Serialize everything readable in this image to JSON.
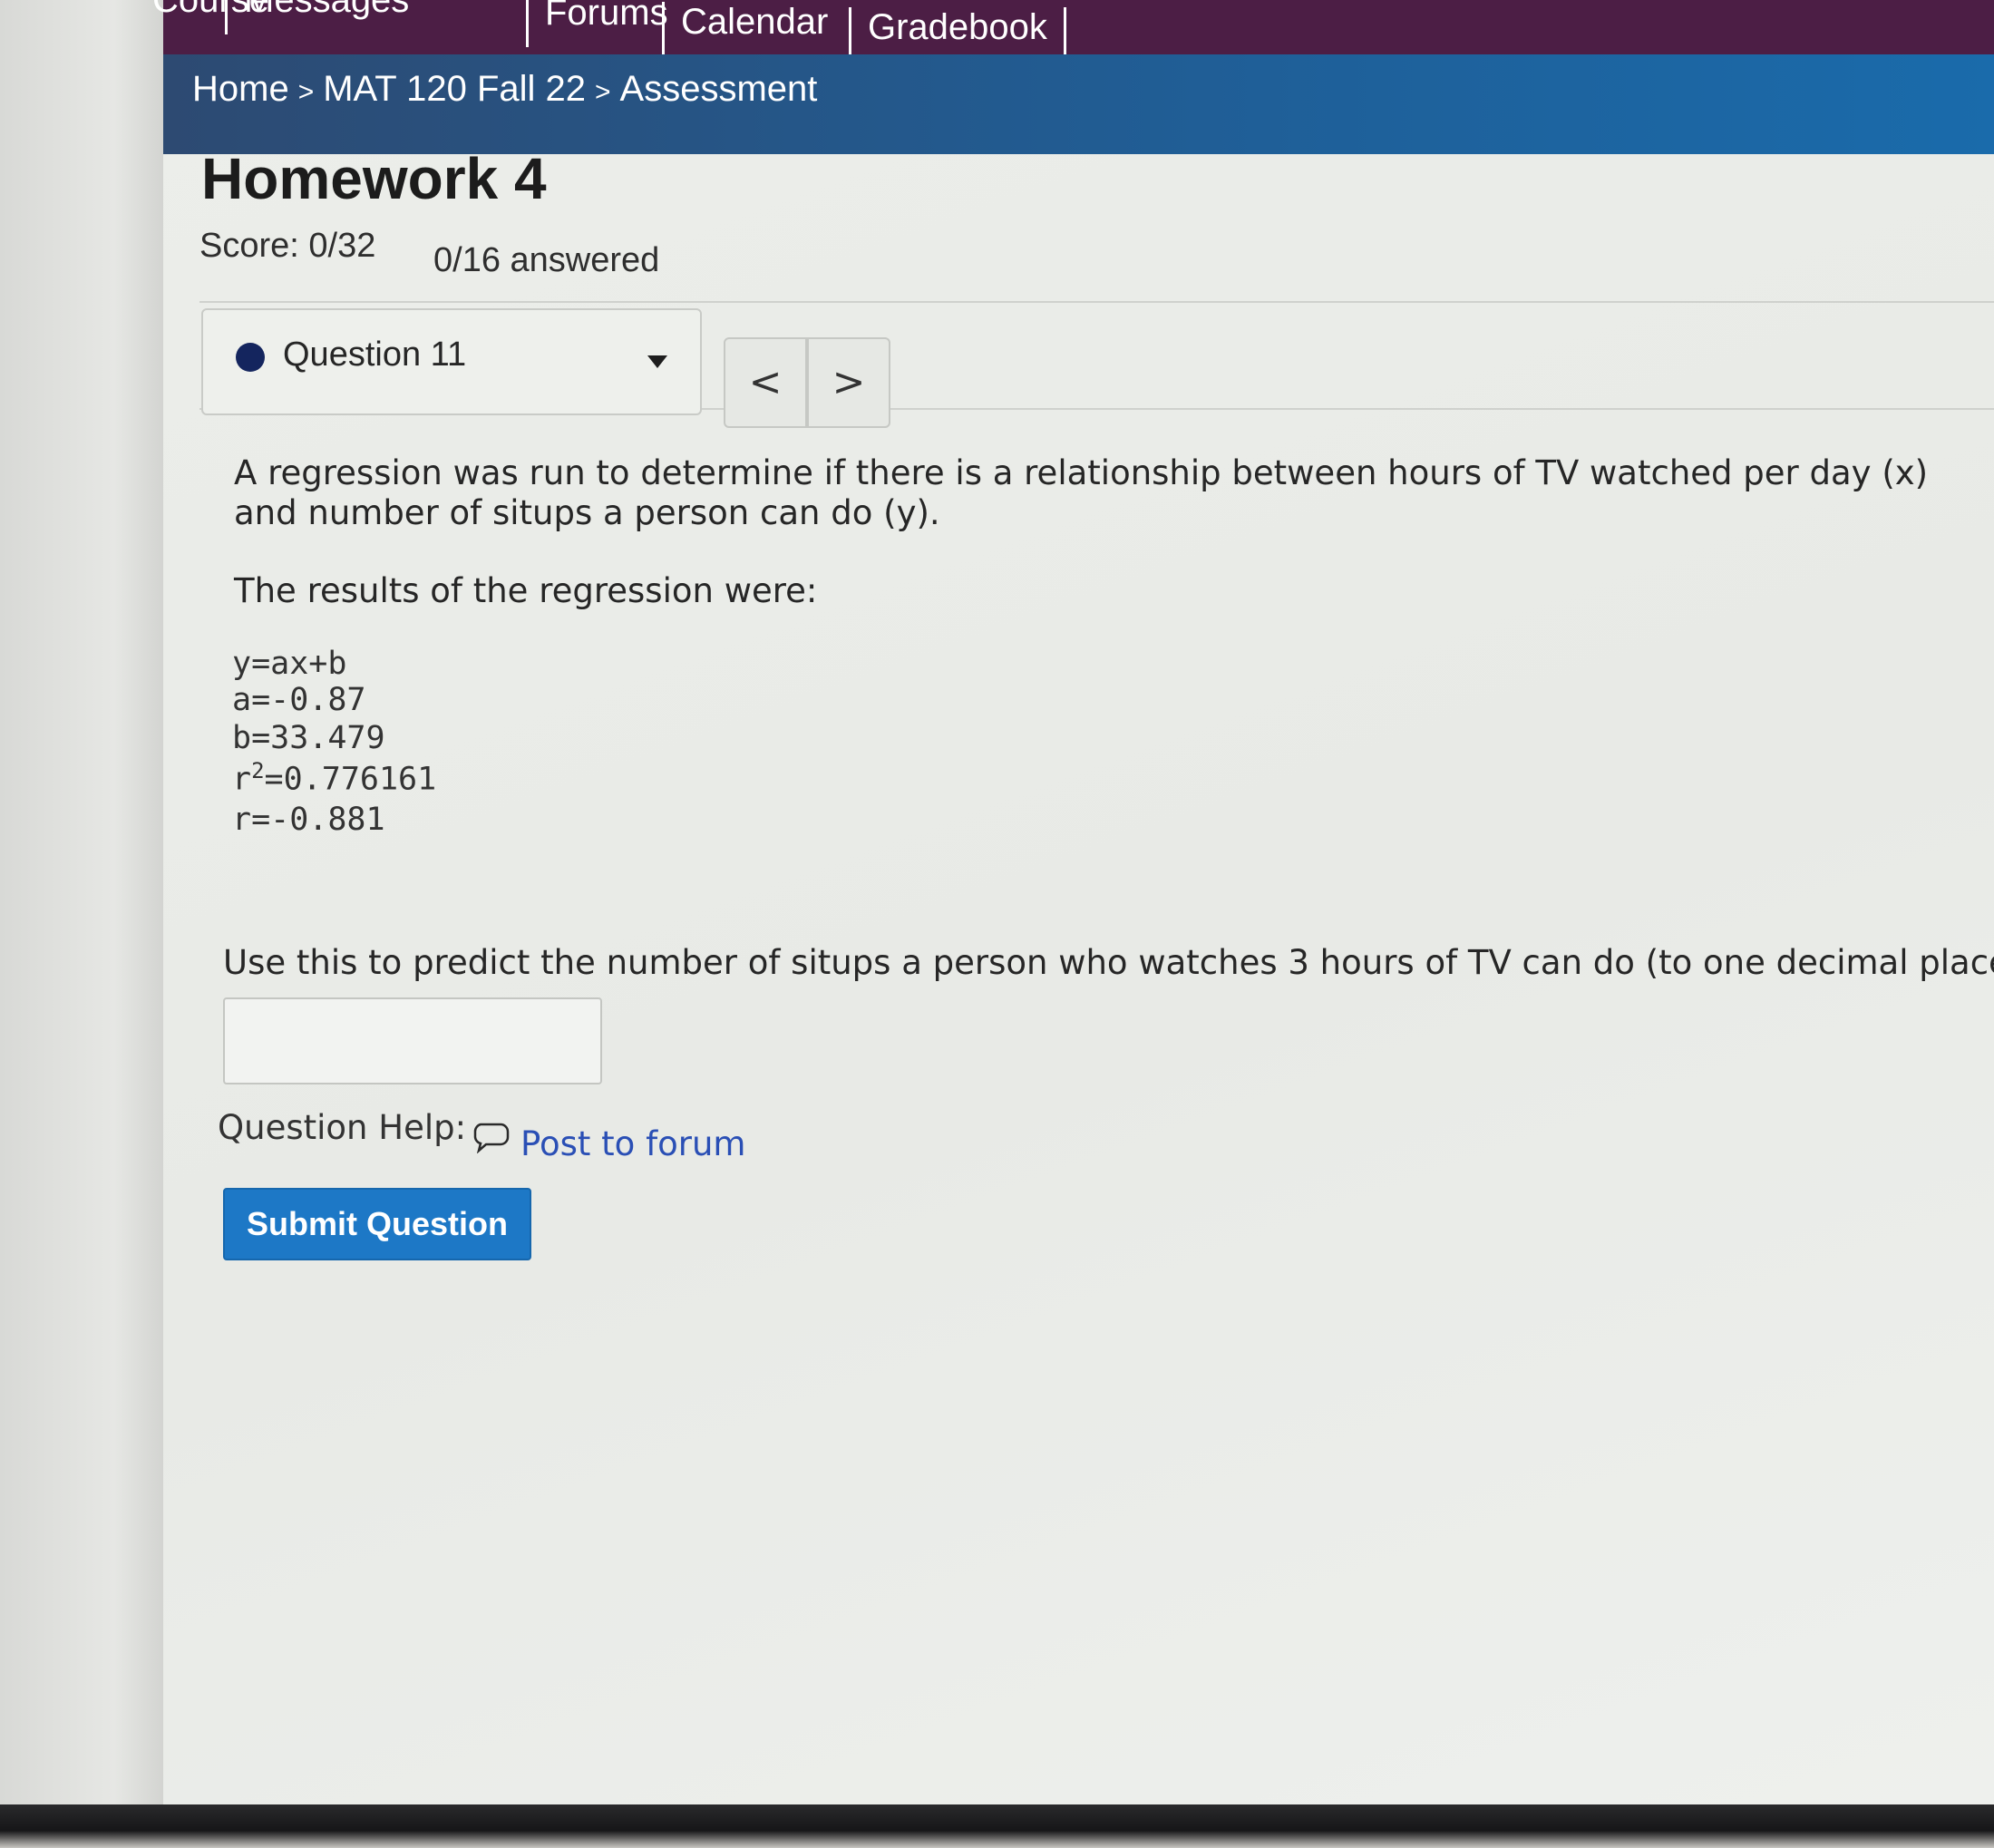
{
  "nav": {
    "tabs": [
      "Course",
      "Messages",
      "Forums",
      "Calendar",
      "Gradebook"
    ]
  },
  "breadcrumb": {
    "items": [
      "Home",
      "MAT 120 Fall 22",
      "Assessment"
    ],
    "separator": ">"
  },
  "assessment": {
    "title": "Homework 4",
    "score": "Score: 0/32",
    "answered": "0/16 answered"
  },
  "question_nav": {
    "selected": "Question 11",
    "prev_symbol": "<",
    "next_symbol": ">"
  },
  "question": {
    "text": "A regression was run to determine if there is a relationship between hours of TV watched per day (x) and number of situps a person can do (y).",
    "results_intro": "The results of the regression were:",
    "equation": "y=ax+b",
    "a": "a=-0.87",
    "b": "b=33.479",
    "r2_prefix": "r",
    "r2_exp": "2",
    "r2_value": "=0.776161",
    "r": "r=-0.881",
    "prompt": "Use this to predict the number of situps a person who watches 3 hours of TV can do (to one decimal place)",
    "answer_value": ""
  },
  "help": {
    "label": "Question Help:",
    "forum_link": "Post to forum"
  },
  "submit_label": "Submit Question",
  "colors": {
    "topnav": "#4c1e45",
    "breadcrumb_bar": "#1f5f98",
    "submit": "#1d78c6",
    "link": "#2a4fb5",
    "question_dot": "#14255e"
  }
}
